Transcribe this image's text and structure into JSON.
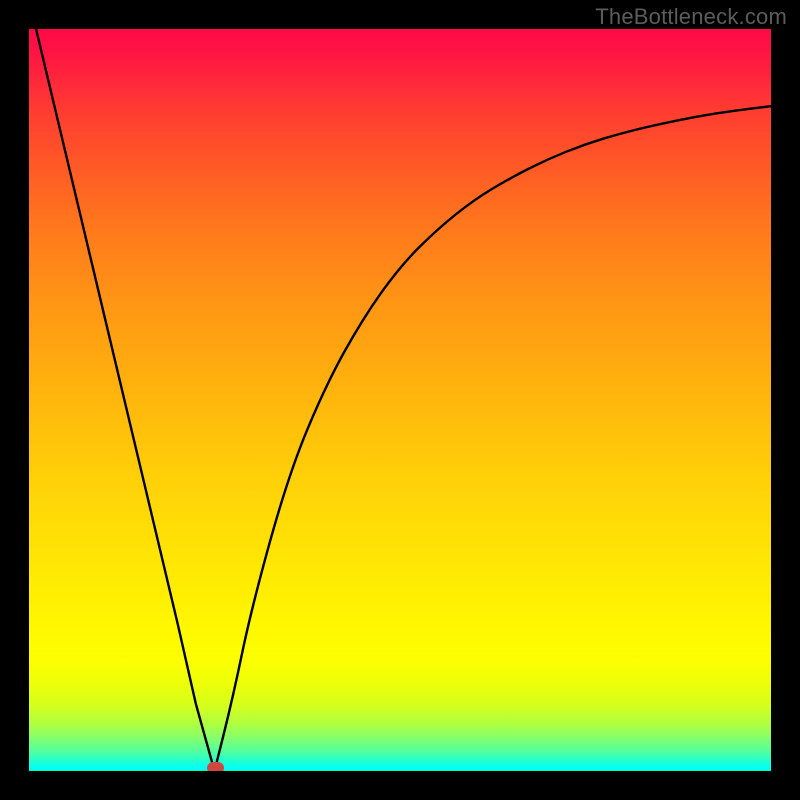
{
  "watermark": "TheBottleneck.com",
  "chart_data": {
    "type": "line",
    "title": "",
    "xlabel": "",
    "ylabel": "",
    "xlim": [
      0,
      100
    ],
    "ylim": [
      0,
      100
    ],
    "grid": false,
    "legend": false,
    "series": [
      {
        "name": "bottleneck-curve",
        "x": [
          0,
          5,
          10,
          15,
          20,
          22.5,
          25,
          27.5,
          30,
          35,
          40,
          45,
          50,
          55,
          60,
          65,
          70,
          75,
          80,
          85,
          90,
          95,
          100
        ],
        "values": [
          104,
          83,
          62,
          41,
          20,
          9,
          0,
          10,
          22,
          40,
          52,
          61,
          68,
          73,
          77,
          80,
          82.5,
          84.5,
          86,
          87.2,
          88.2,
          89,
          89.6
        ]
      }
    ],
    "annotations": [
      {
        "name": "optimum-marker",
        "x": 25.2,
        "y": 0,
        "color": "#cf483f"
      }
    ],
    "background_gradient": {
      "top": "#ff0a46",
      "bottom": "#00ff80"
    }
  }
}
